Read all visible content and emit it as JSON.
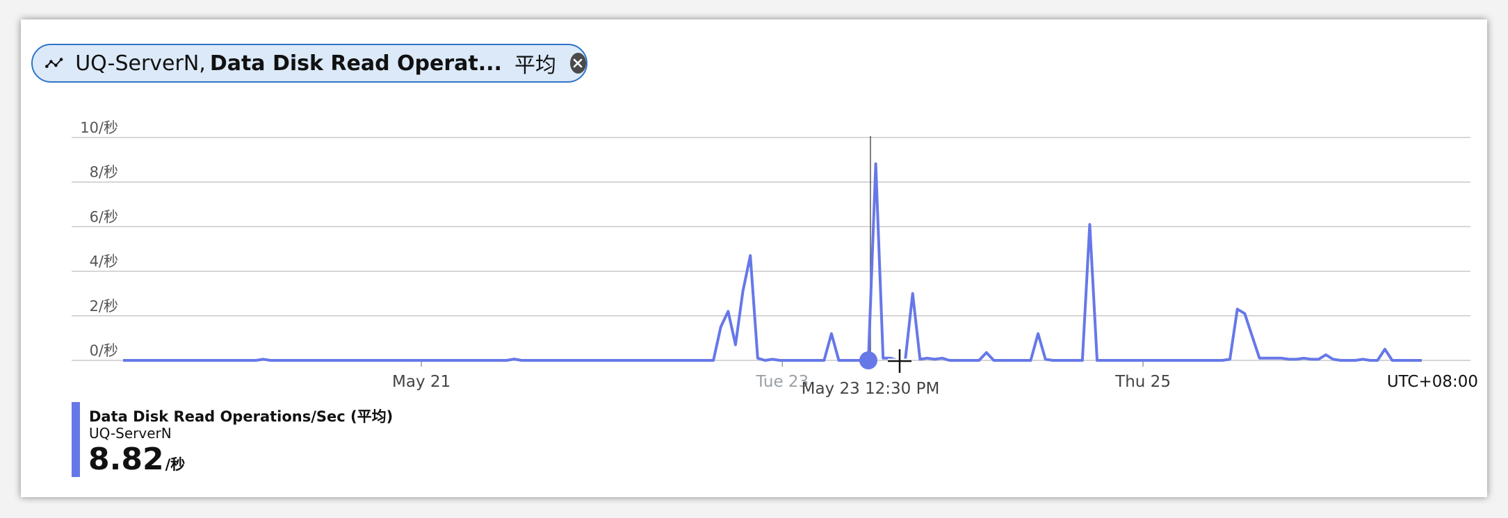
{
  "pill": {
    "resource": "UQ-ServerN,",
    "metric": "Data Disk Read Operat...",
    "aggregation": "平均",
    "icon": "line-chart-icon",
    "close_icon": "close-circle-icon"
  },
  "legend": {
    "metric": "Data Disk Read Operations/Sec (平均)",
    "resource": "UQ-ServerN",
    "value": "8.82",
    "unit": "/秒",
    "color": "#6678e8"
  },
  "hover": {
    "label": "May 23 12:30 PM"
  },
  "timezone": "UTC+08:00",
  "chart_data": {
    "type": "line",
    "title": "",
    "xlabel": "",
    "ylabel": "",
    "ylim": [
      0,
      10
    ],
    "yticks": [
      "0/秒",
      "2/秒",
      "4/秒",
      "6/秒",
      "8/秒",
      "10/秒"
    ],
    "xticks": [
      {
        "label": "May 21",
        "pos": 0.2214,
        "faded": false
      },
      {
        "label": "Tue 23",
        "pos": 0.4893,
        "faded": true
      },
      {
        "label": "Thu 25",
        "pos": 0.757,
        "faded": false
      }
    ],
    "grid": true,
    "hover_index": 101,
    "series": [
      {
        "color": "#6678e8",
        "values": [
          0,
          0,
          0,
          0,
          0,
          0,
          0,
          0,
          0,
          0,
          0,
          0,
          0,
          0,
          0,
          0,
          0,
          0,
          0,
          0.05,
          0,
          0,
          0,
          0,
          0,
          0,
          0,
          0,
          0,
          0,
          0,
          0,
          0,
          0,
          0,
          0,
          0,
          0,
          0,
          0,
          0,
          0,
          0,
          0,
          0,
          0,
          0,
          0,
          0,
          0,
          0,
          0,
          0,
          0.06,
          0,
          0,
          0,
          0,
          0,
          0,
          0,
          0,
          0,
          0,
          0,
          0,
          0,
          0,
          0,
          0,
          0,
          0,
          0,
          0,
          0,
          0,
          0,
          0,
          0,
          0,
          0,
          1.5,
          2.2,
          0.7,
          3.1,
          4.7,
          0.1,
          0,
          0.05,
          0,
          0,
          0,
          0,
          0,
          0,
          0,
          1.2,
          0,
          0,
          0,
          0,
          0,
          8.82,
          0.1,
          0.1,
          0,
          0,
          3.0,
          0.05,
          0.1,
          0.05,
          0.1,
          0,
          0,
          0,
          0,
          0,
          0.35,
          0,
          0,
          0,
          0,
          0,
          0,
          1.2,
          0.05,
          0,
          0,
          0,
          0,
          0,
          6.1,
          0,
          0,
          0,
          0,
          0,
          0,
          0,
          0,
          0,
          0,
          0,
          0,
          0,
          0,
          0,
          0,
          0,
          0,
          0.05,
          2.3,
          2.1,
          1.1,
          0.1,
          0.1,
          0.1,
          0.1,
          0.05,
          0.05,
          0.1,
          0.05,
          0.05,
          0.25,
          0.05,
          0,
          0,
          0,
          0.05,
          0,
          0,
          0.5,
          0,
          0,
          0,
          0,
          0
        ]
      }
    ]
  }
}
